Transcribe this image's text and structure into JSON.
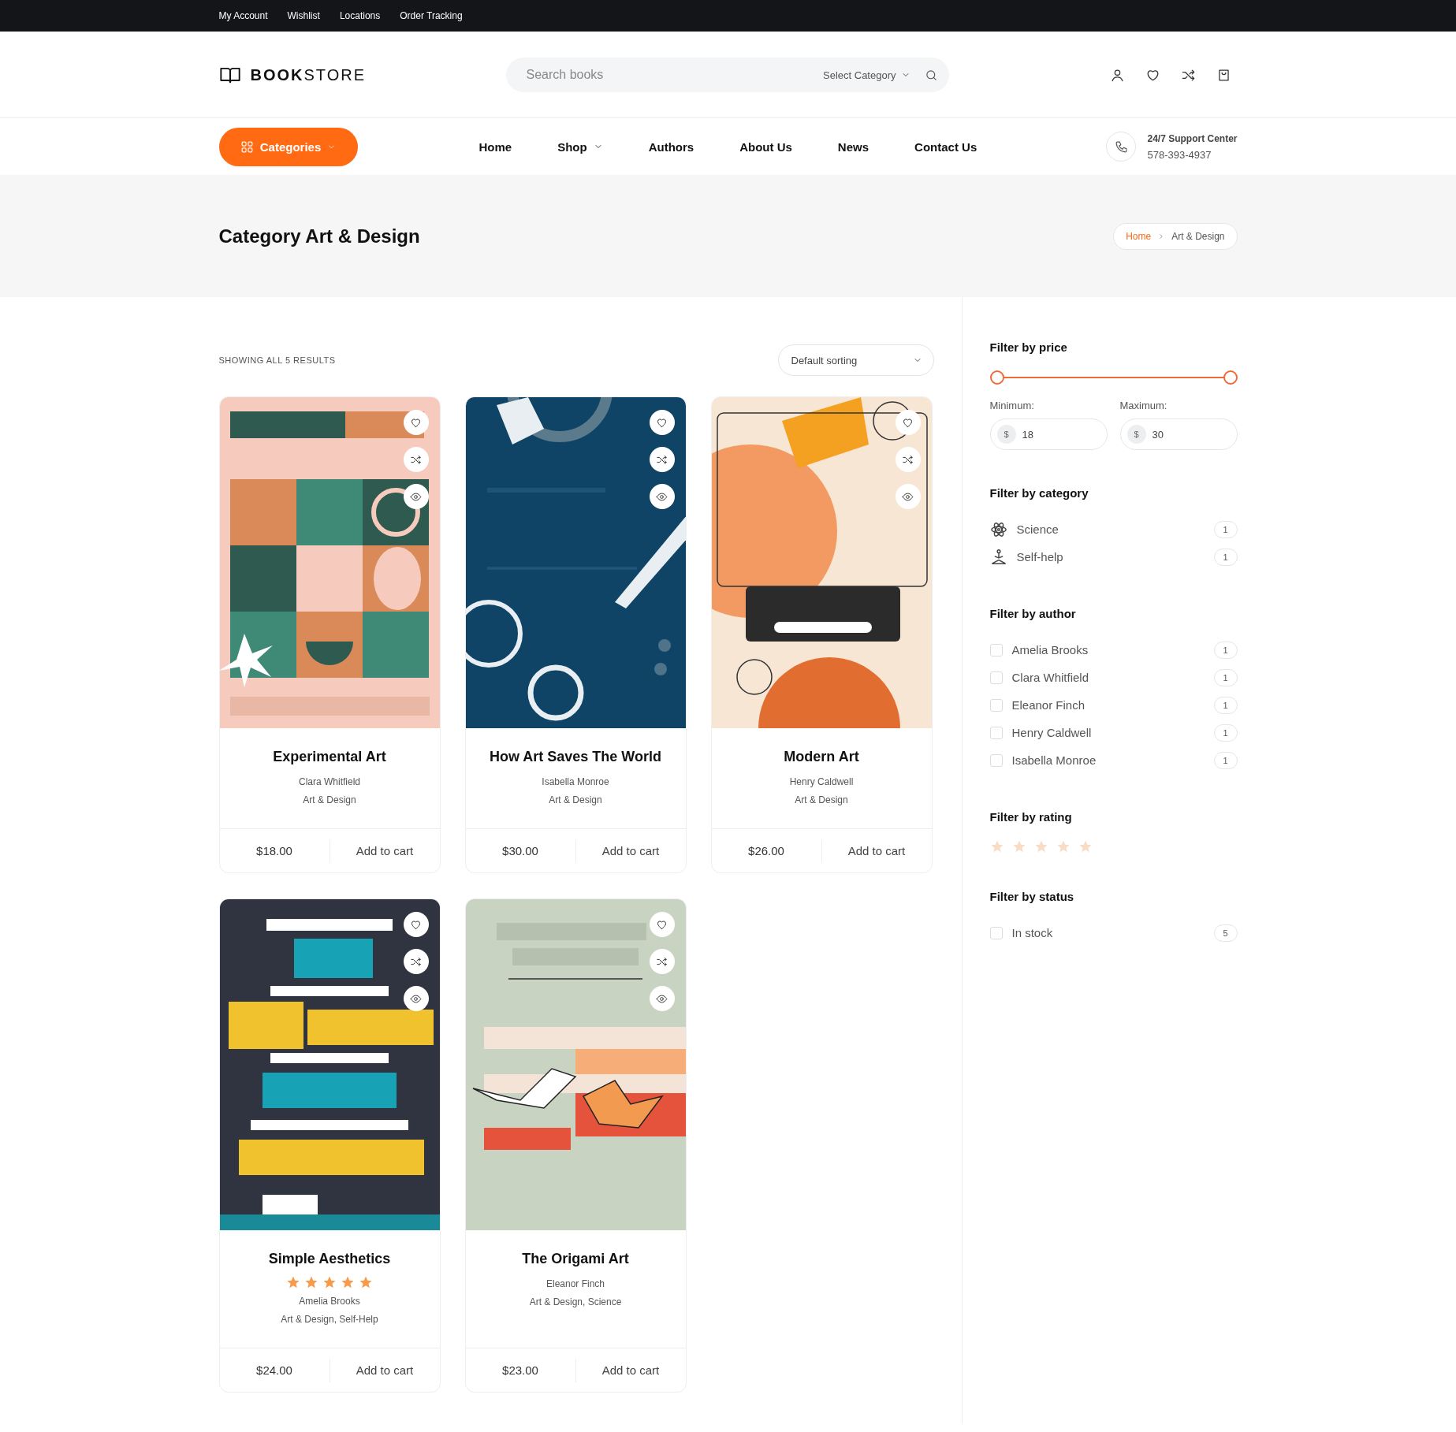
{
  "top_links": [
    "My Account",
    "Wishlist",
    "Locations",
    "Order Tracking"
  ],
  "header": {
    "logo_bold": "BOOK",
    "logo_light": "STORE",
    "search": {
      "placeholder": "Search books"
    },
    "category_select": "Select Category"
  },
  "nav": {
    "categories_button": "Categories",
    "items": [
      {
        "label": "Home",
        "dropdown": false
      },
      {
        "label": "Shop",
        "dropdown": true
      },
      {
        "label": "Authors",
        "dropdown": false
      },
      {
        "label": "About Us",
        "dropdown": false
      },
      {
        "label": "News",
        "dropdown": false
      },
      {
        "label": "Contact Us",
        "dropdown": false
      }
    ],
    "support": {
      "title": "24/7 Support Center",
      "phone": "578-393-4937"
    }
  },
  "page_title": "Category Art & Design",
  "breadcrumb": [
    "Home",
    "Art & Design"
  ],
  "results_text": "SHOWING ALL 5 RESULTS",
  "sorting": "Default sorting",
  "products": [
    {
      "title": "Experimental Art",
      "author": "Clara Whitfield",
      "categories": "Art & Design",
      "price": "$18.00",
      "cart": "Add to cart"
    },
    {
      "title": "How Art Saves The World",
      "author": "Isabella Monroe",
      "categories": "Art & Design",
      "price": "$30.00",
      "cart": "Add to cart"
    },
    {
      "title": "Modern Art",
      "author": "Henry Caldwell",
      "categories": "Art & Design",
      "price": "$26.00",
      "cart": "Add to cart"
    },
    {
      "title": "Simple Aesthetics",
      "stars": 5,
      "author": "Amelia Brooks",
      "categories": "Art & Design, Self-Help",
      "price": "$24.00",
      "cart": "Add to cart"
    },
    {
      "title": "The Origami Art",
      "author": "Eleanor Finch",
      "categories": "Art & Design, Science",
      "price": "$23.00",
      "cart": "Add to cart"
    }
  ],
  "sidebar": {
    "price": {
      "title": "Filter by price",
      "min_label": "Minimum:",
      "max_label": "Maximum:",
      "currency": "$",
      "min": "18",
      "max": "30",
      "handles": [
        {
          "level": 0
        },
        {
          "level": 1
        }
      ]
    },
    "category": {
      "title": "Filter by category",
      "items": [
        {
          "kind": "science",
          "label": "Science",
          "count": "1"
        },
        {
          "kind": "selfhelp",
          "label": "Self-help",
          "count": "1"
        }
      ]
    },
    "author": {
      "title": "Filter by author",
      "items": [
        {
          "label": "Amelia Brooks",
          "count": "1",
          "checked": false
        },
        {
          "label": "Clara Whitfield",
          "count": "1",
          "checked": false
        },
        {
          "label": "Eleanor Finch",
          "count": "1",
          "checked": false
        },
        {
          "label": "Henry Caldwell",
          "count": "1",
          "checked": false
        },
        {
          "label": "Isabella Monroe",
          "count": "1",
          "checked": false
        }
      ]
    },
    "rating": {
      "title": "Filter by rating"
    },
    "status": {
      "title": "Filter by status",
      "items": [
        {
          "label": "In stock",
          "count": "5",
          "checked": false
        }
      ]
    }
  }
}
